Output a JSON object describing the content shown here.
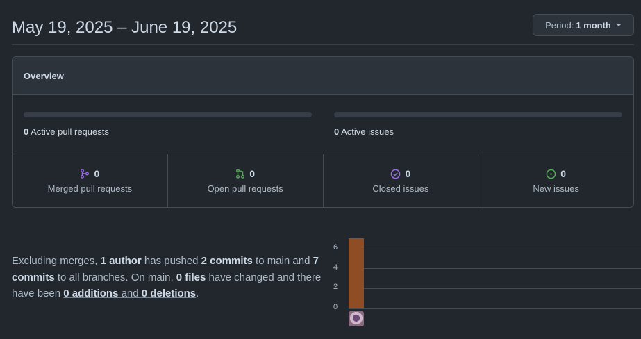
{
  "header": {
    "date_range": "May 19, 2025 – June 19, 2025",
    "period_prefix": "Period:",
    "period_value": "1 month"
  },
  "overview": {
    "title": "Overview",
    "active_prs_count": "0",
    "active_prs_label": "Active pull requests",
    "active_issues_count": "0",
    "active_issues_label": "Active issues",
    "stats": [
      {
        "count": "0",
        "label": "Merged pull requests",
        "icon": "merge-icon",
        "color": "#986ee2"
      },
      {
        "count": "0",
        "label": "Open pull requests",
        "icon": "pull-request-icon",
        "color": "#57ab5a"
      },
      {
        "count": "0",
        "label": "Closed issues",
        "icon": "issue-closed-icon",
        "color": "#986ee2"
      },
      {
        "count": "0",
        "label": "New issues",
        "icon": "issue-opened-icon",
        "color": "#57ab5a"
      }
    ]
  },
  "summary": {
    "t1": "Excluding merges, ",
    "authors": "1 author",
    "t2": " has pushed ",
    "commits_main": "2 commits",
    "t3": " to main and ",
    "commits_all": "7 commits",
    "t4": " to all branches. On main, ",
    "files": "0 files",
    "t5": " have changed and there have been ",
    "additions_num": "0",
    "additions_word": " additions",
    "t6": " and ",
    "deletions_num": "0",
    "deletions_word": " deletions",
    "t7": "."
  },
  "chart_data": {
    "type": "bar",
    "categories": [
      "author-1"
    ],
    "values": [
      7
    ],
    "yticks": [
      "0",
      "2",
      "4",
      "6"
    ],
    "ylim": [
      0,
      7
    ],
    "bar_color": "#8f4d26"
  }
}
